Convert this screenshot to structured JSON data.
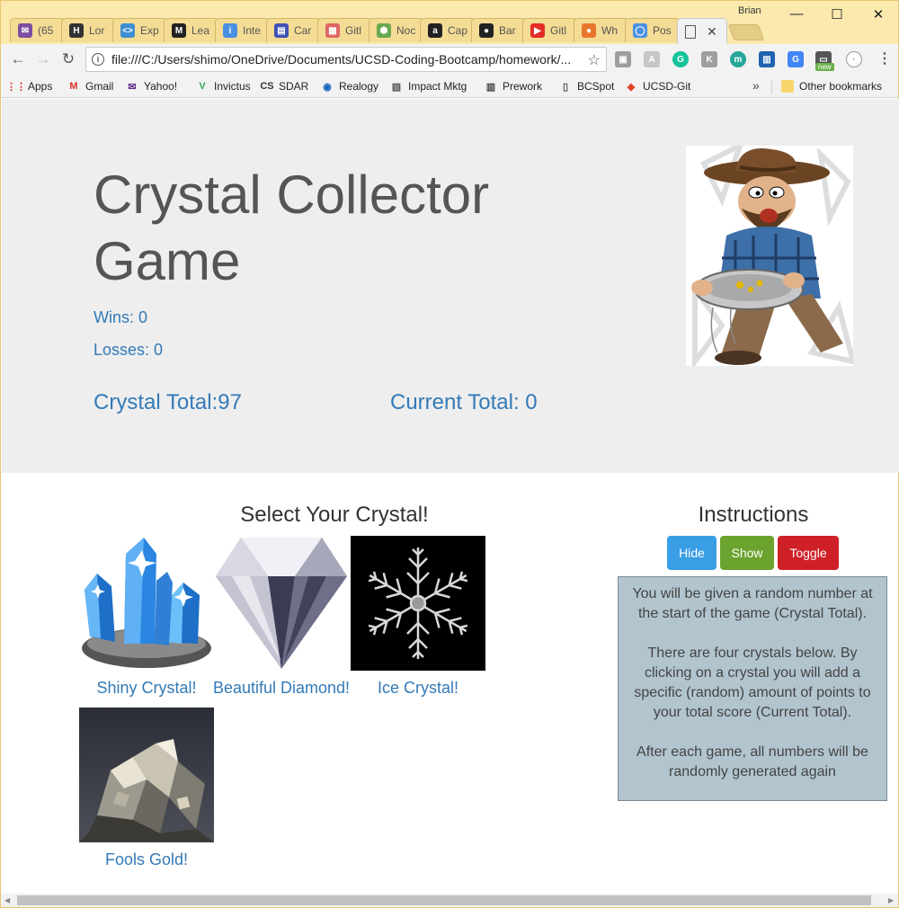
{
  "browser": {
    "profile_name": "Brian",
    "tabs": [
      {
        "label": "(65",
        "icon": "mail-icon",
        "color": "#7b4fa0",
        "glyph": "✉"
      },
      {
        "label": "Lor",
        "icon": "hipsum-icon",
        "color": "#333333",
        "glyph": "H"
      },
      {
        "label": "Exp",
        "icon": "code-icon",
        "color": "#3e8ed0",
        "glyph": "<>"
      },
      {
        "label": "Lea",
        "icon": "medium-icon",
        "color": "#222222",
        "glyph": "M"
      },
      {
        "label": "Inte",
        "icon": "info-icon",
        "color": "#4a90e2",
        "glyph": "i"
      },
      {
        "label": "Car",
        "icon": "layout-icon",
        "color": "#3f51b5",
        "glyph": "▤"
      },
      {
        "label": "Gitl",
        "icon": "film-icon",
        "color": "#e06666",
        "glyph": "▦"
      },
      {
        "label": "Noc",
        "icon": "node-icon",
        "color": "#6aa84f",
        "glyph": "⬢"
      },
      {
        "label": "Cap",
        "icon": "amazon-icon",
        "color": "#222222",
        "glyph": "a"
      },
      {
        "label": "Bar",
        "icon": "github-icon",
        "color": "#222222",
        "glyph": "●"
      },
      {
        "label": "Gitl",
        "icon": "youtube-icon",
        "color": "#e52d27",
        "glyph": "▶"
      },
      {
        "label": "Wh",
        "icon": "firefox-icon",
        "color": "#e8762d",
        "glyph": "●"
      },
      {
        "label": "Pos",
        "icon": "circle-icon",
        "color": "#4a90e2",
        "glyph": "◯"
      }
    ],
    "active_tab_icon": "page-icon",
    "address_url": "file:///C:/Users/shimo/OneDrive/Documents/UCSD-Coding-Bootcamp/homework/...",
    "bookmarks": [
      {
        "label": "Apps",
        "icon": "apps-grid-icon",
        "color": "#d93025",
        "glyph": "⋮⋮"
      },
      {
        "label": "Gmail",
        "icon": "gmail-icon",
        "color": "#d93025",
        "glyph": "M"
      },
      {
        "label": "Yahoo!",
        "icon": "mail-icon",
        "color": "#5f2a84",
        "glyph": "✉"
      },
      {
        "label": "Invictus",
        "icon": "v-icon",
        "color": "#34a853",
        "glyph": "V"
      },
      {
        "label": "SDAR",
        "icon": "cs-icon",
        "color": "#333333",
        "glyph": "CS"
      },
      {
        "label": "Realogy",
        "icon": "circle-icon",
        "color": "#1565c0",
        "glyph": "◉"
      },
      {
        "label": "Impact Mktg",
        "icon": "image-icon",
        "color": "#555555",
        "glyph": "▨"
      },
      {
        "label": "Prework",
        "icon": "book-icon",
        "color": "#444444",
        "glyph": "▥"
      },
      {
        "label": "BCSpot",
        "icon": "page-icon",
        "color": "#555555",
        "glyph": "▯"
      },
      {
        "label": "UCSD-Git",
        "icon": "gitlab-icon",
        "color": "#e24329",
        "glyph": "◆"
      }
    ],
    "other_bookmarks": "Other bookmarks",
    "extension_new_badge": "new"
  },
  "game": {
    "title": "Crystal Collector Game",
    "wins_label": "Wins: 0",
    "losses_label": "Losses: 0",
    "crystal_total_label": "Crystal Total:97",
    "current_total_label": "Current Total: 0",
    "select_heading": "Select Your Crystal!",
    "crystals": [
      {
        "label": "Shiny Crystal!"
      },
      {
        "label": "Beautiful Diamond!"
      },
      {
        "label": "Ice Crystal!"
      },
      {
        "label": "Fools Gold!"
      }
    ]
  },
  "instructions": {
    "heading": "Instructions",
    "buttons": {
      "hide": "Hide",
      "show": "Show",
      "toggle": "Toggle"
    },
    "button_colors": {
      "hide": "#3a9ee5",
      "show": "#6ca32f",
      "toggle": "#cf2027"
    },
    "paragraphs": [
      "You will be given a random number at the start of the game (Crystal Total).",
      "There are four crystals below. By clicking on a crystal you will add a specific (random) amount of points to your total score (Current Total).",
      "After each game, all numbers will be randomly generated again"
    ]
  }
}
